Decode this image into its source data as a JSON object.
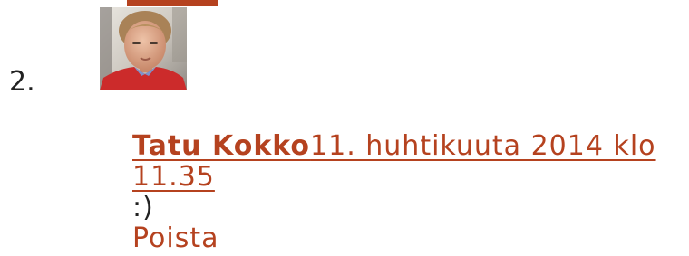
{
  "comment": {
    "number": "2.",
    "author": "Tatu Kokko",
    "timestamp": "11. huhtikuuta 2014 klo 11.35",
    "text": ":)",
    "delete_label": "Poista",
    "avatar_icon": "author-avatar-photo"
  },
  "colors": {
    "link": "#b5421f",
    "text": "#222222",
    "avatar_shirt": "#cc2b2b"
  }
}
